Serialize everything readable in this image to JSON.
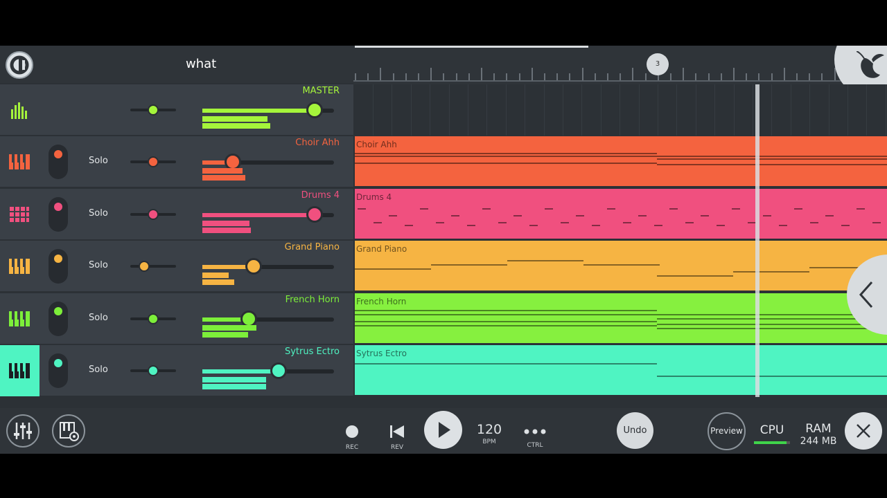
{
  "project": {
    "title": "what"
  },
  "ruler": {
    "bar_marker": "3"
  },
  "master": {
    "name": "MASTER",
    "color": "#a5f53b",
    "pan": 0.5,
    "volume": 0.85
  },
  "channels": [
    {
      "name": "Choir Ahh",
      "solo": "Solo",
      "color": "#f4633f",
      "pan": 0.5,
      "volume": 0.23
    },
    {
      "name": "Drums 4",
      "solo": "Solo",
      "color": "#f0507f",
      "pan": 0.5,
      "volume": 0.85
    },
    {
      "name": "Grand Piano",
      "solo": "Solo",
      "color": "#f6b443",
      "pan": 0.3,
      "volume": 0.39
    },
    {
      "name": "French Horn",
      "solo": "Solo",
      "color": "#7def3a",
      "pan": 0.5,
      "volume": 0.35
    },
    {
      "name": "Sytrus Ectro",
      "solo": "Solo",
      "color": "#4ff4c2",
      "pan": 0.5,
      "volume": 0.58
    }
  ],
  "patterns": [
    {
      "label": "Choir Ahh",
      "color": "#f4633f"
    },
    {
      "label": "Drums 4",
      "color": "#f0507f"
    },
    {
      "label": "Grand Piano",
      "color": "#f6b443"
    },
    {
      "label": "French Horn",
      "color": "#86f03f"
    },
    {
      "label": "Sytrus Ectro",
      "color": "#4ff4c2"
    }
  ],
  "transport": {
    "rec": "REC",
    "rev": "REV",
    "tempo": "120",
    "tempo_unit": "BPM",
    "ctrl": "CTRL",
    "undo": "Undo",
    "preview": "Preview"
  },
  "status": {
    "cpu_label": "CPU",
    "cpu_load": 0.9,
    "ram_label": "RAM",
    "ram_value": "244 MB"
  },
  "icons": [
    "fl-logo-icon",
    "mixer-icon",
    "piano-roll-icon",
    "drum-pads-icon",
    "play-icon",
    "rev-icon",
    "rec-icon",
    "close-icon",
    "chevron-left-icon",
    "fruit-icon",
    "mixer-sliders-icon",
    "channel-settings-icon",
    "ctrl-dots-icon"
  ]
}
